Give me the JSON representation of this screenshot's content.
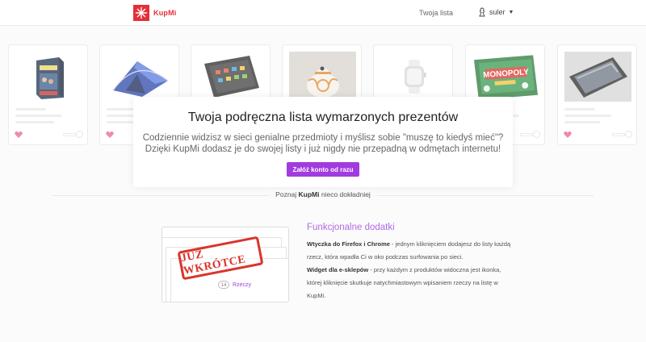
{
  "nav": {
    "brand": "KupMi",
    "link": "Twoja lista",
    "username": "suler"
  },
  "cards": [
    {
      "name": "board-game",
      "heart": true
    },
    {
      "name": "tent",
      "heart": true
    },
    {
      "name": "tablet",
      "heart": false
    },
    {
      "name": "bb8-robot",
      "heart": false
    },
    {
      "name": "smartwatch",
      "heart": false
    },
    {
      "name": "monopoly",
      "heart": true,
      "label": "MONOPOLY"
    },
    {
      "name": "smartphone",
      "heart": true
    }
  ],
  "modal": {
    "title": "Twoja podręczna lista wymarzonych prezentów",
    "line1": "Codziennie widzisz w sieci genialne przedmioty i myślisz sobie \"muszę to kiedyś mieć\"?",
    "line2": "Dzięki KupMi dodasz je do swojej listy i już nigdy nie przepadną w odmętach internetu!",
    "cta": "Załóż konto od razu"
  },
  "poznaj": {
    "before": "Poznaj ",
    "brand": "KupMi",
    "after": " nieco dokładniej"
  },
  "feature": {
    "title": "Funkcjonalne dodatki",
    "b1": "Wtyczka do Firefox i Chrome",
    "t1": " - jednym kliknięciem dodajesz do listy każdą rzecz, która wpadła Ci w oko podczas surfowania po sieci.",
    "b2": "Widget dla e-sklepów",
    "t2": " - przy każdym z produktów widoczna jest ikonka, której kliknięcie skutkuje natychmiastowym wpisaniem rzeczy na listę w KupMi.",
    "stamp": "JUŻ WKRÓTCE",
    "counter_num": "14",
    "counter_label": "Rzeczy"
  },
  "colors": {
    "brand_red": "#e52e3a",
    "accent_purple": "#a13be0",
    "heart_pink": "#e8658f"
  }
}
